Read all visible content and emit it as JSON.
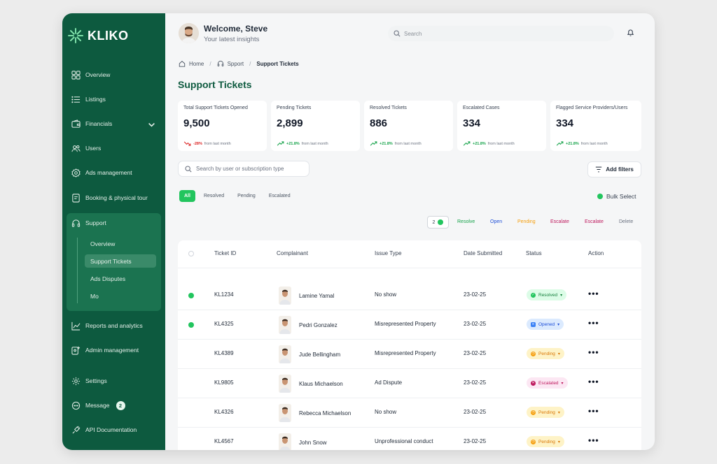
{
  "brand": {
    "name": "KLIKO"
  },
  "sidebar": {
    "items": [
      {
        "label": "Overview"
      },
      {
        "label": "Listings"
      },
      {
        "label": "Financials"
      },
      {
        "label": "Users"
      },
      {
        "label": "Ads management"
      },
      {
        "label": "Booking & physical tour"
      },
      {
        "label": "Support"
      },
      {
        "label": "Reports and analytics"
      },
      {
        "label": "Admin management"
      },
      {
        "label": "Settings"
      },
      {
        "label": "Message",
        "badge": "2"
      },
      {
        "label": "API Documentation"
      }
    ],
    "support_sub": [
      {
        "label": "Overview"
      },
      {
        "label": "Support Tickets"
      },
      {
        "label": "Ads Disputes"
      },
      {
        "label": "Mo"
      }
    ]
  },
  "header": {
    "welcome": "Welcome, Steve",
    "subtitle": "Your latest insights",
    "search_placeholder": "Search"
  },
  "breadcrumb": {
    "home": "Home",
    "section": "Spport",
    "current": "Support Tickets"
  },
  "page_title": "Support Tickets",
  "stats": [
    {
      "label": "Total Support Tickets Opened",
      "value": "9,500",
      "delta": "-28%",
      "delta_text": "from last month",
      "trend": "down"
    },
    {
      "label": "Pending Tickets",
      "value": "2,899",
      "delta": "+21.8%",
      "delta_text": "from last month",
      "trend": "up"
    },
    {
      "label": "Resolved Tickets",
      "value": "886",
      "delta": "+21.8%",
      "delta_text": "from last month",
      "trend": "up"
    },
    {
      "label": "Escalated Cases",
      "value": "334",
      "delta": "+21.8%",
      "delta_text": "from last month",
      "trend": "up"
    },
    {
      "label": "Flagged Service Providers/Users",
      "value": "334",
      "delta": "+21.8%",
      "delta_text": "from last month",
      "trend": "up"
    }
  ],
  "filters": {
    "search_placeholder": "Search by user or subscription type",
    "add_filters": "Add filters",
    "tabs": [
      "All",
      "Resolved",
      "Pending",
      "Escalated"
    ],
    "bulk_select": "Bulk Select"
  },
  "bulk_actions": {
    "count": "2",
    "actions": [
      {
        "label": "Resolve",
        "color": "#16a34a"
      },
      {
        "label": "Open",
        "color": "#1d4ed8"
      },
      {
        "label": "Pending",
        "color": "#f59e0b"
      },
      {
        "label": "Escalate",
        "color": "#be185d"
      },
      {
        "label": "Escalate",
        "color": "#be185d"
      },
      {
        "label": "Delete",
        "color": "#6b7280"
      }
    ]
  },
  "table": {
    "columns": [
      "Ticket ID",
      "Complainant",
      "Issue Type",
      "Date Submitted",
      "Status",
      "Action"
    ],
    "rows": [
      {
        "selected": true,
        "id": "KL1234",
        "complainant": "Lamine Yamal",
        "issue": "No show",
        "date": "23-02-25",
        "status": "Resolved"
      },
      {
        "selected": true,
        "id": "KL4325",
        "complainant": "Pedri Gonzalez",
        "issue": "Misrepresented Property",
        "date": "23-02-25",
        "status": "Opened"
      },
      {
        "selected": false,
        "id": "KL4389",
        "complainant": "Jude Bellingham",
        "issue": "Misrepresented Property",
        "date": "23-02-25",
        "status": "Pending"
      },
      {
        "selected": false,
        "id": "KL9805",
        "complainant": "Klaus Michaelson",
        "issue": "Ad Dispute",
        "date": "23-02-25",
        "status": "Escalated"
      },
      {
        "selected": false,
        "id": "KL4326",
        "complainant": "Rebecca Michaelson",
        "issue": "No show",
        "date": "23-02-25",
        "status": "Pending"
      },
      {
        "selected": false,
        "id": "KL4567",
        "complainant": "John Snow",
        "issue": "Unprofessional conduct",
        "date": "23-02-25",
        "status": "Pending"
      }
    ]
  },
  "colors": {
    "sidebar_bg": "#0d5a3f",
    "accent_green": "#22c55e",
    "title_green": "#0d5a3f"
  }
}
